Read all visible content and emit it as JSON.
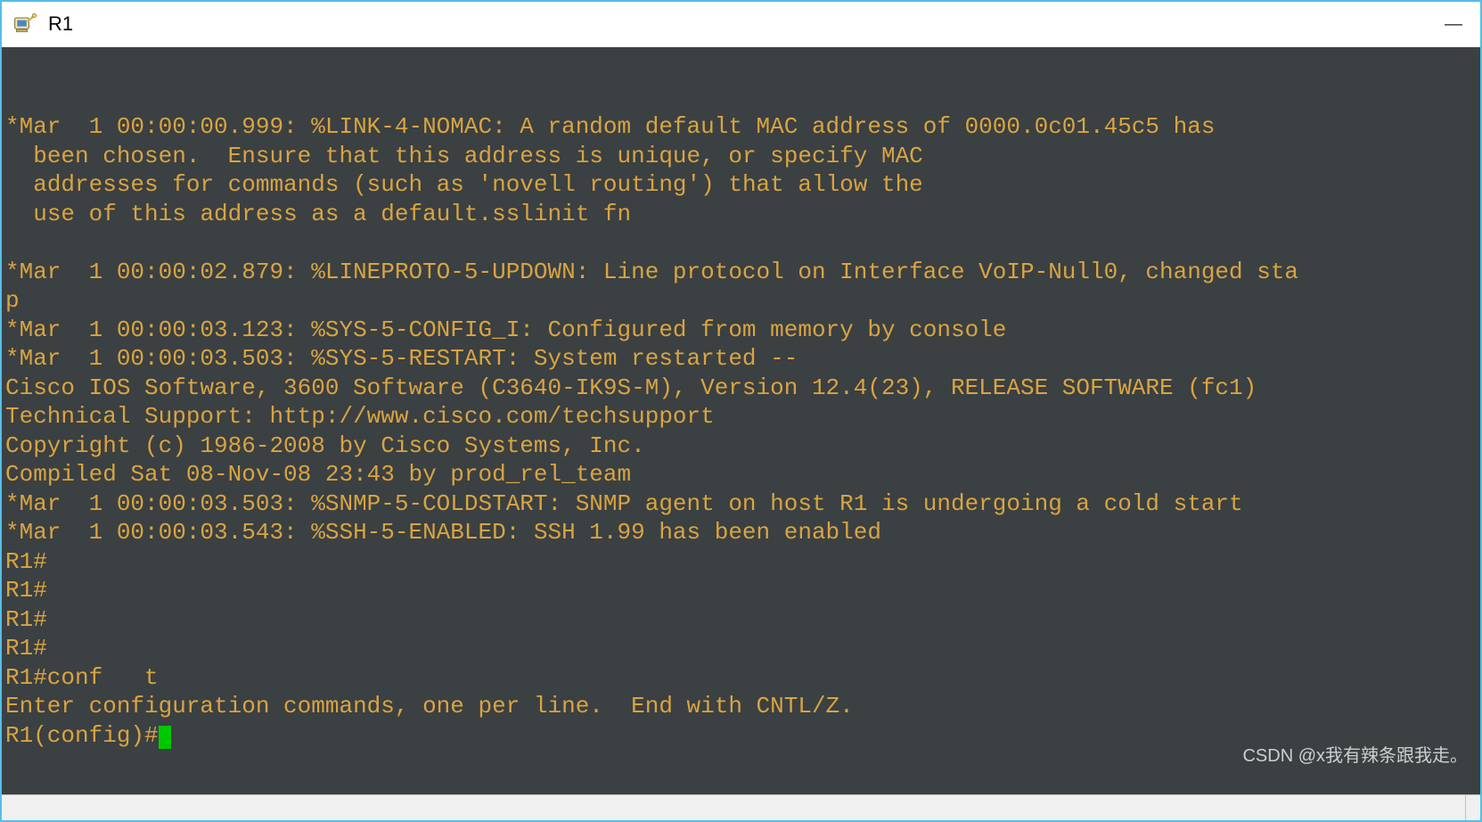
{
  "window": {
    "title": "R1",
    "minimize_glyph": "—"
  },
  "terminal": {
    "lines": [
      "",
      "",
      "*Mar  1 00:00:00.999: %LINK-4-NOMAC: A random default MAC address of 0000.0c01.45c5 has",
      "  been chosen.  Ensure that this address is unique, or specify MAC",
      "  addresses for commands (such as 'novell routing') that allow the",
      "  use of this address as a default.sslinit fn",
      "",
      "*Mar  1 00:00:02.879: %LINEPROTO-5-UPDOWN: Line protocol on Interface VoIP-Null0, changed sta",
      "p",
      "*Mar  1 00:00:03.123: %SYS-5-CONFIG_I: Configured from memory by console",
      "*Mar  1 00:00:03.503: %SYS-5-RESTART: System restarted --",
      "Cisco IOS Software, 3600 Software (C3640-IK9S-M), Version 12.4(23), RELEASE SOFTWARE (fc1)",
      "Technical Support: http://www.cisco.com/techsupport",
      "Copyright (c) 1986-2008 by Cisco Systems, Inc.",
      "Compiled Sat 08-Nov-08 23:43 by prod_rel_team",
      "*Mar  1 00:00:03.503: %SNMP-5-COLDSTART: SNMP agent on host R1 is undergoing a cold start",
      "*Mar  1 00:00:03.543: %SSH-5-ENABLED: SSH 1.99 has been enabled",
      "R1#",
      "R1#",
      "R1#",
      "R1#",
      "R1#conf   t",
      "Enter configuration commands, one per line.  End with CNTL/Z."
    ],
    "prompt": "R1(config)#"
  },
  "watermark": "CSDN @x我有辣条跟我走。",
  "status": {
    "right_text": ""
  }
}
